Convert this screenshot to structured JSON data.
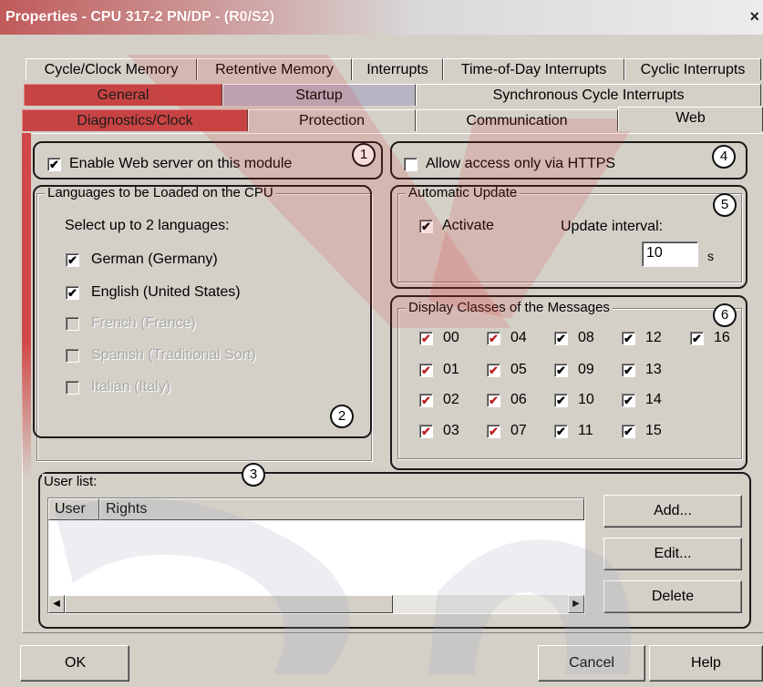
{
  "window": {
    "title": "Properties - CPU 317-2 PN/DP - (R0/S2)",
    "close_glyph": "×"
  },
  "tabs": {
    "row1": [
      "Cycle/Clock Memory",
      "Retentive Memory",
      "Interrupts",
      "Time-of-Day Interrupts",
      "Cyclic Interrupts"
    ],
    "row2": [
      "General",
      "Startup",
      "Synchronous Cycle Interrupts"
    ],
    "row3": [
      "Diagnostics/Clock",
      "Protection",
      "Communication",
      "Web"
    ],
    "active": "Web"
  },
  "web": {
    "enable_server": {
      "label": "Enable Web server on this module",
      "checked": true
    },
    "https_only": {
      "label": "Allow access only via HTTPS",
      "checked": false
    },
    "languages": {
      "title": "Languages to be Loaded on the CPU",
      "hint": "Select up to 2 languages:",
      "items": [
        {
          "label": "German (Germany)",
          "checked": true,
          "enabled": true
        },
        {
          "label": "English (United States)",
          "checked": true,
          "enabled": true
        },
        {
          "label": "French (France)",
          "checked": false,
          "enabled": false
        },
        {
          "label": "Spanish (Traditional Sort)",
          "checked": false,
          "enabled": false
        },
        {
          "label": "Italian (Italy)",
          "checked": false,
          "enabled": false
        }
      ]
    },
    "auto_update": {
      "title": "Automatic Update",
      "activate_label": "Activate",
      "activate_checked": true,
      "interval_label": "Update interval:",
      "interval_value": "10",
      "interval_unit": "s"
    },
    "message_classes": {
      "title": "Display Classes of the Messages",
      "items": [
        "00",
        "01",
        "02",
        "03",
        "04",
        "05",
        "06",
        "07",
        "08",
        "09",
        "10",
        "11",
        "12",
        "13",
        "14",
        "15",
        "16"
      ],
      "all_checked": true
    },
    "user_list": {
      "title": "User list:",
      "columns": [
        "User",
        "Rights"
      ],
      "rows": [],
      "buttons": {
        "add": "Add...",
        "edit": "Edit...",
        "delete": "Delete"
      }
    },
    "callouts": [
      "1",
      "2",
      "3",
      "4",
      "5",
      "6"
    ]
  },
  "footer": {
    "ok": "OK",
    "cancel": "Cancel",
    "help": "Help"
  },
  "colors": {
    "dialog": "#d4d0c8",
    "accent_red": "#c84444",
    "callout_outline": "#1a1a1a"
  },
  "checkmark": "✔",
  "scroll": {
    "left_glyph": "◀",
    "right_glyph": "▶"
  }
}
